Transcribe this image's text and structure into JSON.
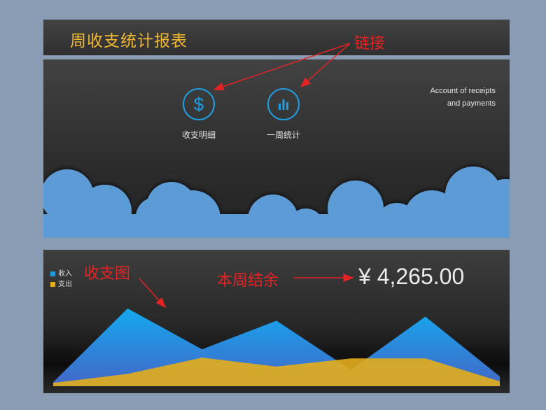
{
  "header": {
    "title": "周收支统计报表"
  },
  "nav": [
    {
      "label": "收支明细",
      "icon": "dollar-icon"
    },
    {
      "label": "一周统计",
      "icon": "bar-chart-icon"
    }
  ],
  "tagline": {
    "line1": "Account of receipts",
    "line2": "and payments"
  },
  "colors": {
    "income": "#1e9be0",
    "expense": "#e3ad1b",
    "title": "#f2b830",
    "cloud": "#5b9bd5",
    "annotation": "#e32424"
  },
  "balance": {
    "currency": "¥",
    "amount": "4,265.00"
  },
  "chart_data": {
    "type": "area",
    "x": [
      1,
      2,
      3,
      4,
      5,
      6,
      7
    ],
    "series": [
      {
        "name": "收入",
        "values": [
          0.05,
          0.95,
          0.45,
          0.8,
          0.2,
          0.85,
          0.12
        ]
      },
      {
        "name": "支出",
        "values": [
          0.04,
          0.15,
          0.35,
          0.24,
          0.34,
          0.34,
          0.06
        ]
      }
    ],
    "ylim": [
      0,
      1
    ],
    "grid": false,
    "legend": "top-left"
  },
  "annotations": {
    "link": "链接",
    "chart": "收支图",
    "balance": "本周结余"
  }
}
